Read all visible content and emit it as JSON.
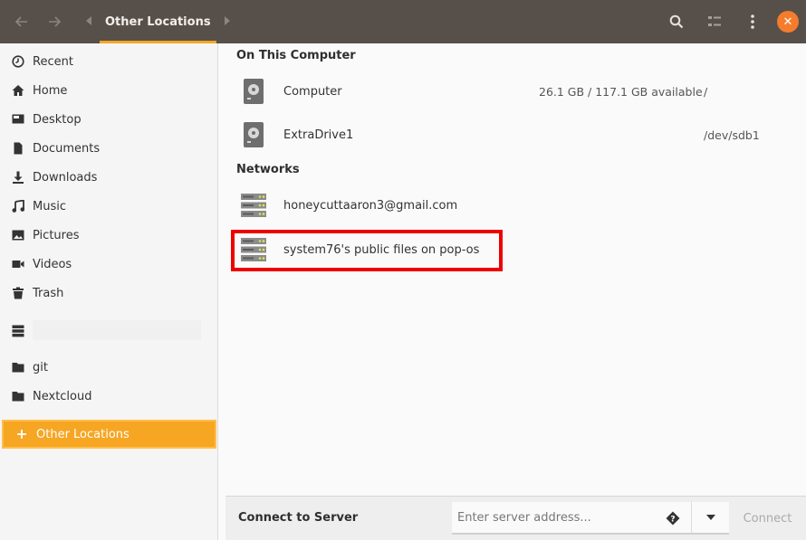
{
  "header": {
    "back_icon": "back-arrow-icon",
    "forward_icon": "forward-arrow-icon",
    "path_current": "Other Locations",
    "search_icon": "search-icon",
    "view_icon": "list-view-icon",
    "menu_icon": "kebab-menu-icon",
    "close_icon": "close-icon"
  },
  "sidebar": {
    "items": [
      {
        "label": "Recent",
        "icon": "clock-icon"
      },
      {
        "label": "Home",
        "icon": "home-icon"
      },
      {
        "label": "Desktop",
        "icon": "desktop-icon"
      },
      {
        "label": "Documents",
        "icon": "document-icon"
      },
      {
        "label": "Downloads",
        "icon": "download-icon"
      },
      {
        "label": "Music",
        "icon": "music-icon"
      },
      {
        "label": "Pictures",
        "icon": "picture-icon"
      },
      {
        "label": "Videos",
        "icon": "video-icon"
      },
      {
        "label": "Trash",
        "icon": "trash-icon"
      },
      {
        "label": "",
        "icon": "network-server-icon"
      },
      {
        "label": "git",
        "icon": "folder-icon"
      },
      {
        "label": "Nextcloud",
        "icon": "folder-icon"
      },
      {
        "label": "Other Locations",
        "icon": "plus-icon"
      }
    ]
  },
  "main": {
    "on_this_computer": "On This Computer",
    "computer_rows": [
      {
        "name": "Computer",
        "available": "26.1 GB  /  117.1 GB available",
        "path": "/"
      },
      {
        "name": "ExtraDrive1",
        "available": "",
        "path": "/dev/sdb1"
      }
    ],
    "networks": "Networks",
    "network_rows": [
      {
        "name": "honeycuttaaron3@gmail.com"
      },
      {
        "name": "system76's public files on pop-os"
      }
    ]
  },
  "connect": {
    "label": "Connect to Server",
    "placeholder": "Enter server address...",
    "button": "Connect"
  },
  "colors": {
    "headerbar": "#574f4a",
    "accent": "#f6a623",
    "close": "#f47c2c",
    "highlight": "#ee0000"
  }
}
